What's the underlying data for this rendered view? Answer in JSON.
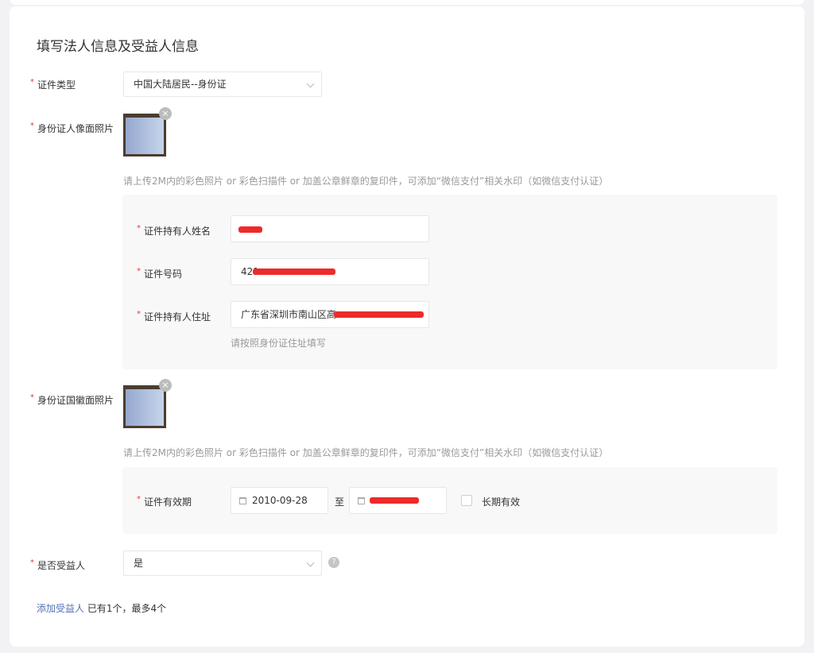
{
  "page": {
    "title": "填写法人信息及受益人信息"
  },
  "form": {
    "id_type": {
      "label": "证件类型",
      "value": "中国大陆居民--身份证"
    },
    "front_photo": {
      "label": "身份证人像面照片",
      "hint": "请上传2M内的彩色照片 or 彩色扫描件 or 加盖公章鲜章的复印件，可添加“微信支付”相关水印（如微信支付认证）"
    },
    "holder_name": {
      "label": "证件持有人姓名",
      "value": ""
    },
    "id_number": {
      "label": "证件号码",
      "value": "421"
    },
    "holder_address": {
      "label": "证件持有人住址",
      "value": "广东省深圳市南山区高",
      "hint": "请按照身份证住址填写"
    },
    "back_photo": {
      "label": "身份证国徽面照片",
      "hint": "请上传2M内的彩色照片 or 彩色扫描件 or 加盖公章鲜章的复印件，可添加“微信支付”相关水印（如微信支付认证）"
    },
    "validity": {
      "label": "证件有效期",
      "start": "2010-09-28",
      "separator": "至",
      "end": "",
      "long_term_label": "长期有效",
      "long_term_checked": false
    },
    "is_beneficiary": {
      "label": "是否受益人",
      "value": "是",
      "help": "?"
    },
    "beneficiary": {
      "add_link": "添加受益人",
      "count_text": "已有1个，最多4个"
    }
  },
  "icons": {
    "required": "*",
    "delete": "×",
    "calendar": "calendar-icon",
    "chevron": "chevron-down-icon"
  },
  "colors": {
    "required": "#e23c3c",
    "link": "#5372b5",
    "redaction": "#ee2a2a"
  }
}
